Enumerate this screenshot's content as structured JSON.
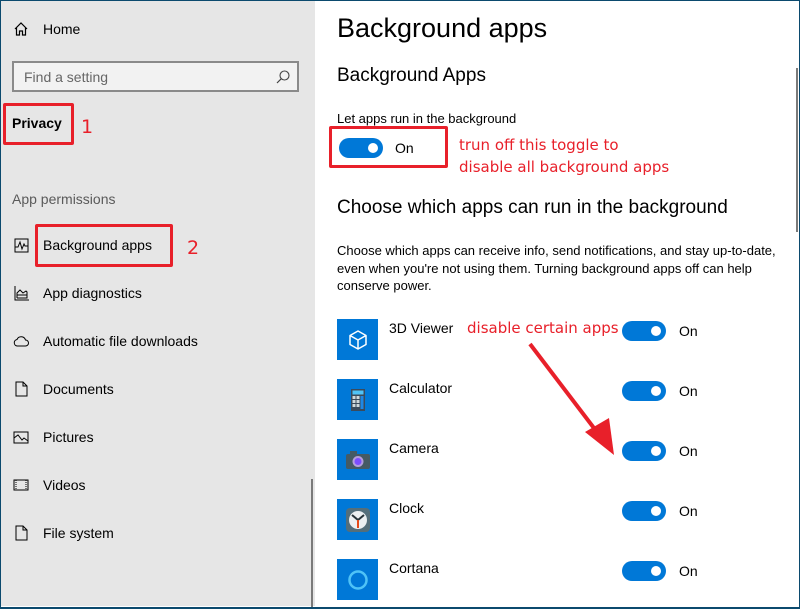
{
  "sidebar": {
    "home_label": "Home",
    "search_placeholder": "Find a setting",
    "category": "Privacy",
    "section_header": "App permissions",
    "items": [
      {
        "label": "Background apps",
        "icon": "background-apps-icon"
      },
      {
        "label": "App diagnostics",
        "icon": "app-diagnostics-icon"
      },
      {
        "label": "Automatic file downloads",
        "icon": "cloud-icon"
      },
      {
        "label": "Documents",
        "icon": "document-icon"
      },
      {
        "label": "Pictures",
        "icon": "pictures-icon"
      },
      {
        "label": "Videos",
        "icon": "video-icon"
      },
      {
        "label": "File system",
        "icon": "file-icon"
      }
    ]
  },
  "main": {
    "title": "Background apps",
    "section_title": "Background Apps",
    "master_toggle_label": "Let apps run in the background",
    "master_toggle_state": "On",
    "choose_title": "Choose which apps can run in the background",
    "description": "Choose which apps can receive info, send notifications, and stay up-to-date, even when you're not using them. Turning background apps off can help conserve power.",
    "apps": [
      {
        "name": "3D Viewer",
        "state": "On",
        "icon": "3d-viewer-icon"
      },
      {
        "name": "Calculator",
        "state": "On",
        "icon": "calculator-icon"
      },
      {
        "name": "Camera",
        "state": "On",
        "icon": "camera-icon"
      },
      {
        "name": "Clock",
        "state": "On",
        "icon": "clock-icon"
      },
      {
        "name": "Cortana",
        "state": "On",
        "icon": "cortana-icon"
      }
    ]
  },
  "annotations": {
    "step1": "1",
    "step2": "2",
    "toggle_note_line1": "trun off this toggle to",
    "toggle_note_line2": "disable all background apps",
    "apps_note": "disable certain apps",
    "accent_color": "#e8202a"
  },
  "colors": {
    "toggle_on": "#0078d7",
    "sidebar_bg": "#e6e6e6"
  }
}
